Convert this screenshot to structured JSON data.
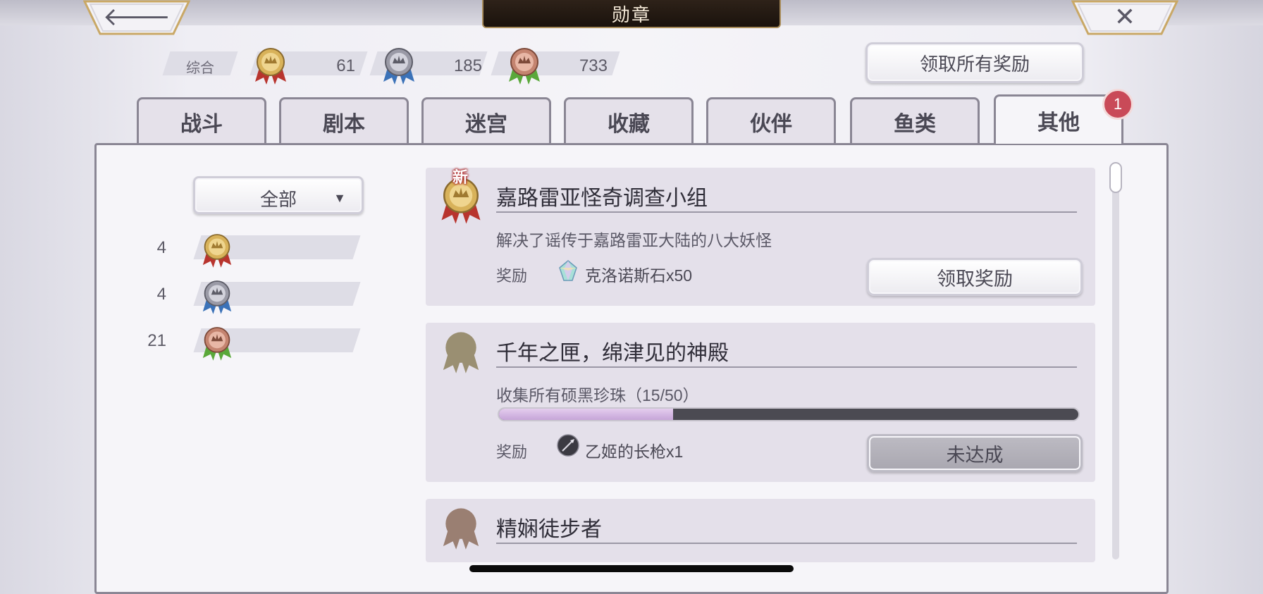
{
  "header": {
    "title": "勋章",
    "back_icon": "left-arrow-icon",
    "close_icon": "close-x-icon"
  },
  "summary": {
    "label": "综合",
    "gold": "61",
    "silver": "185",
    "bronze": "733"
  },
  "claim_all_label": "领取所有奖励",
  "tabs": [
    {
      "label": "战斗"
    },
    {
      "label": "剧本"
    },
    {
      "label": "迷宫"
    },
    {
      "label": "收藏"
    },
    {
      "label": "伙伴"
    },
    {
      "label": "鱼类"
    },
    {
      "label": "其他",
      "active": true
    }
  ],
  "tab_badge": "1",
  "filter": {
    "selected": "全部",
    "counts": {
      "gold": "4",
      "silver": "4",
      "bronze": "21"
    }
  },
  "reward_label": "奖励",
  "medals": [
    {
      "tier": "gold",
      "new_tag": "新",
      "title": "嘉路雷亚怪奇调查小组",
      "desc": "解决了谣传于嘉路雷亚大陆的八大妖怪",
      "reward": "克洛诺斯石x50",
      "reward_icon": "chronos-stone-icon",
      "action": "领取奖励"
    },
    {
      "tier": "locked-gold",
      "title": "千年之匣，绵津见的神殿",
      "desc": "收集所有硕黑珍珠（15/50）",
      "progress": 0.3,
      "reward": "乙姬的长枪x1",
      "reward_icon": "spear-icon",
      "action": "未达成"
    },
    {
      "tier": "locked-bronze",
      "title": "精娴徒步者"
    }
  ],
  "colors": {
    "gold": "#d8b25a",
    "silver": "#9a9aa6",
    "bronze": "#c48470",
    "red_ribbon": "#b8342e",
    "blue_ribbon": "#3b72b8",
    "green_ribbon": "#5aa83a",
    "badge": "#c94a58",
    "progress_fill": "#c6a5d8"
  }
}
